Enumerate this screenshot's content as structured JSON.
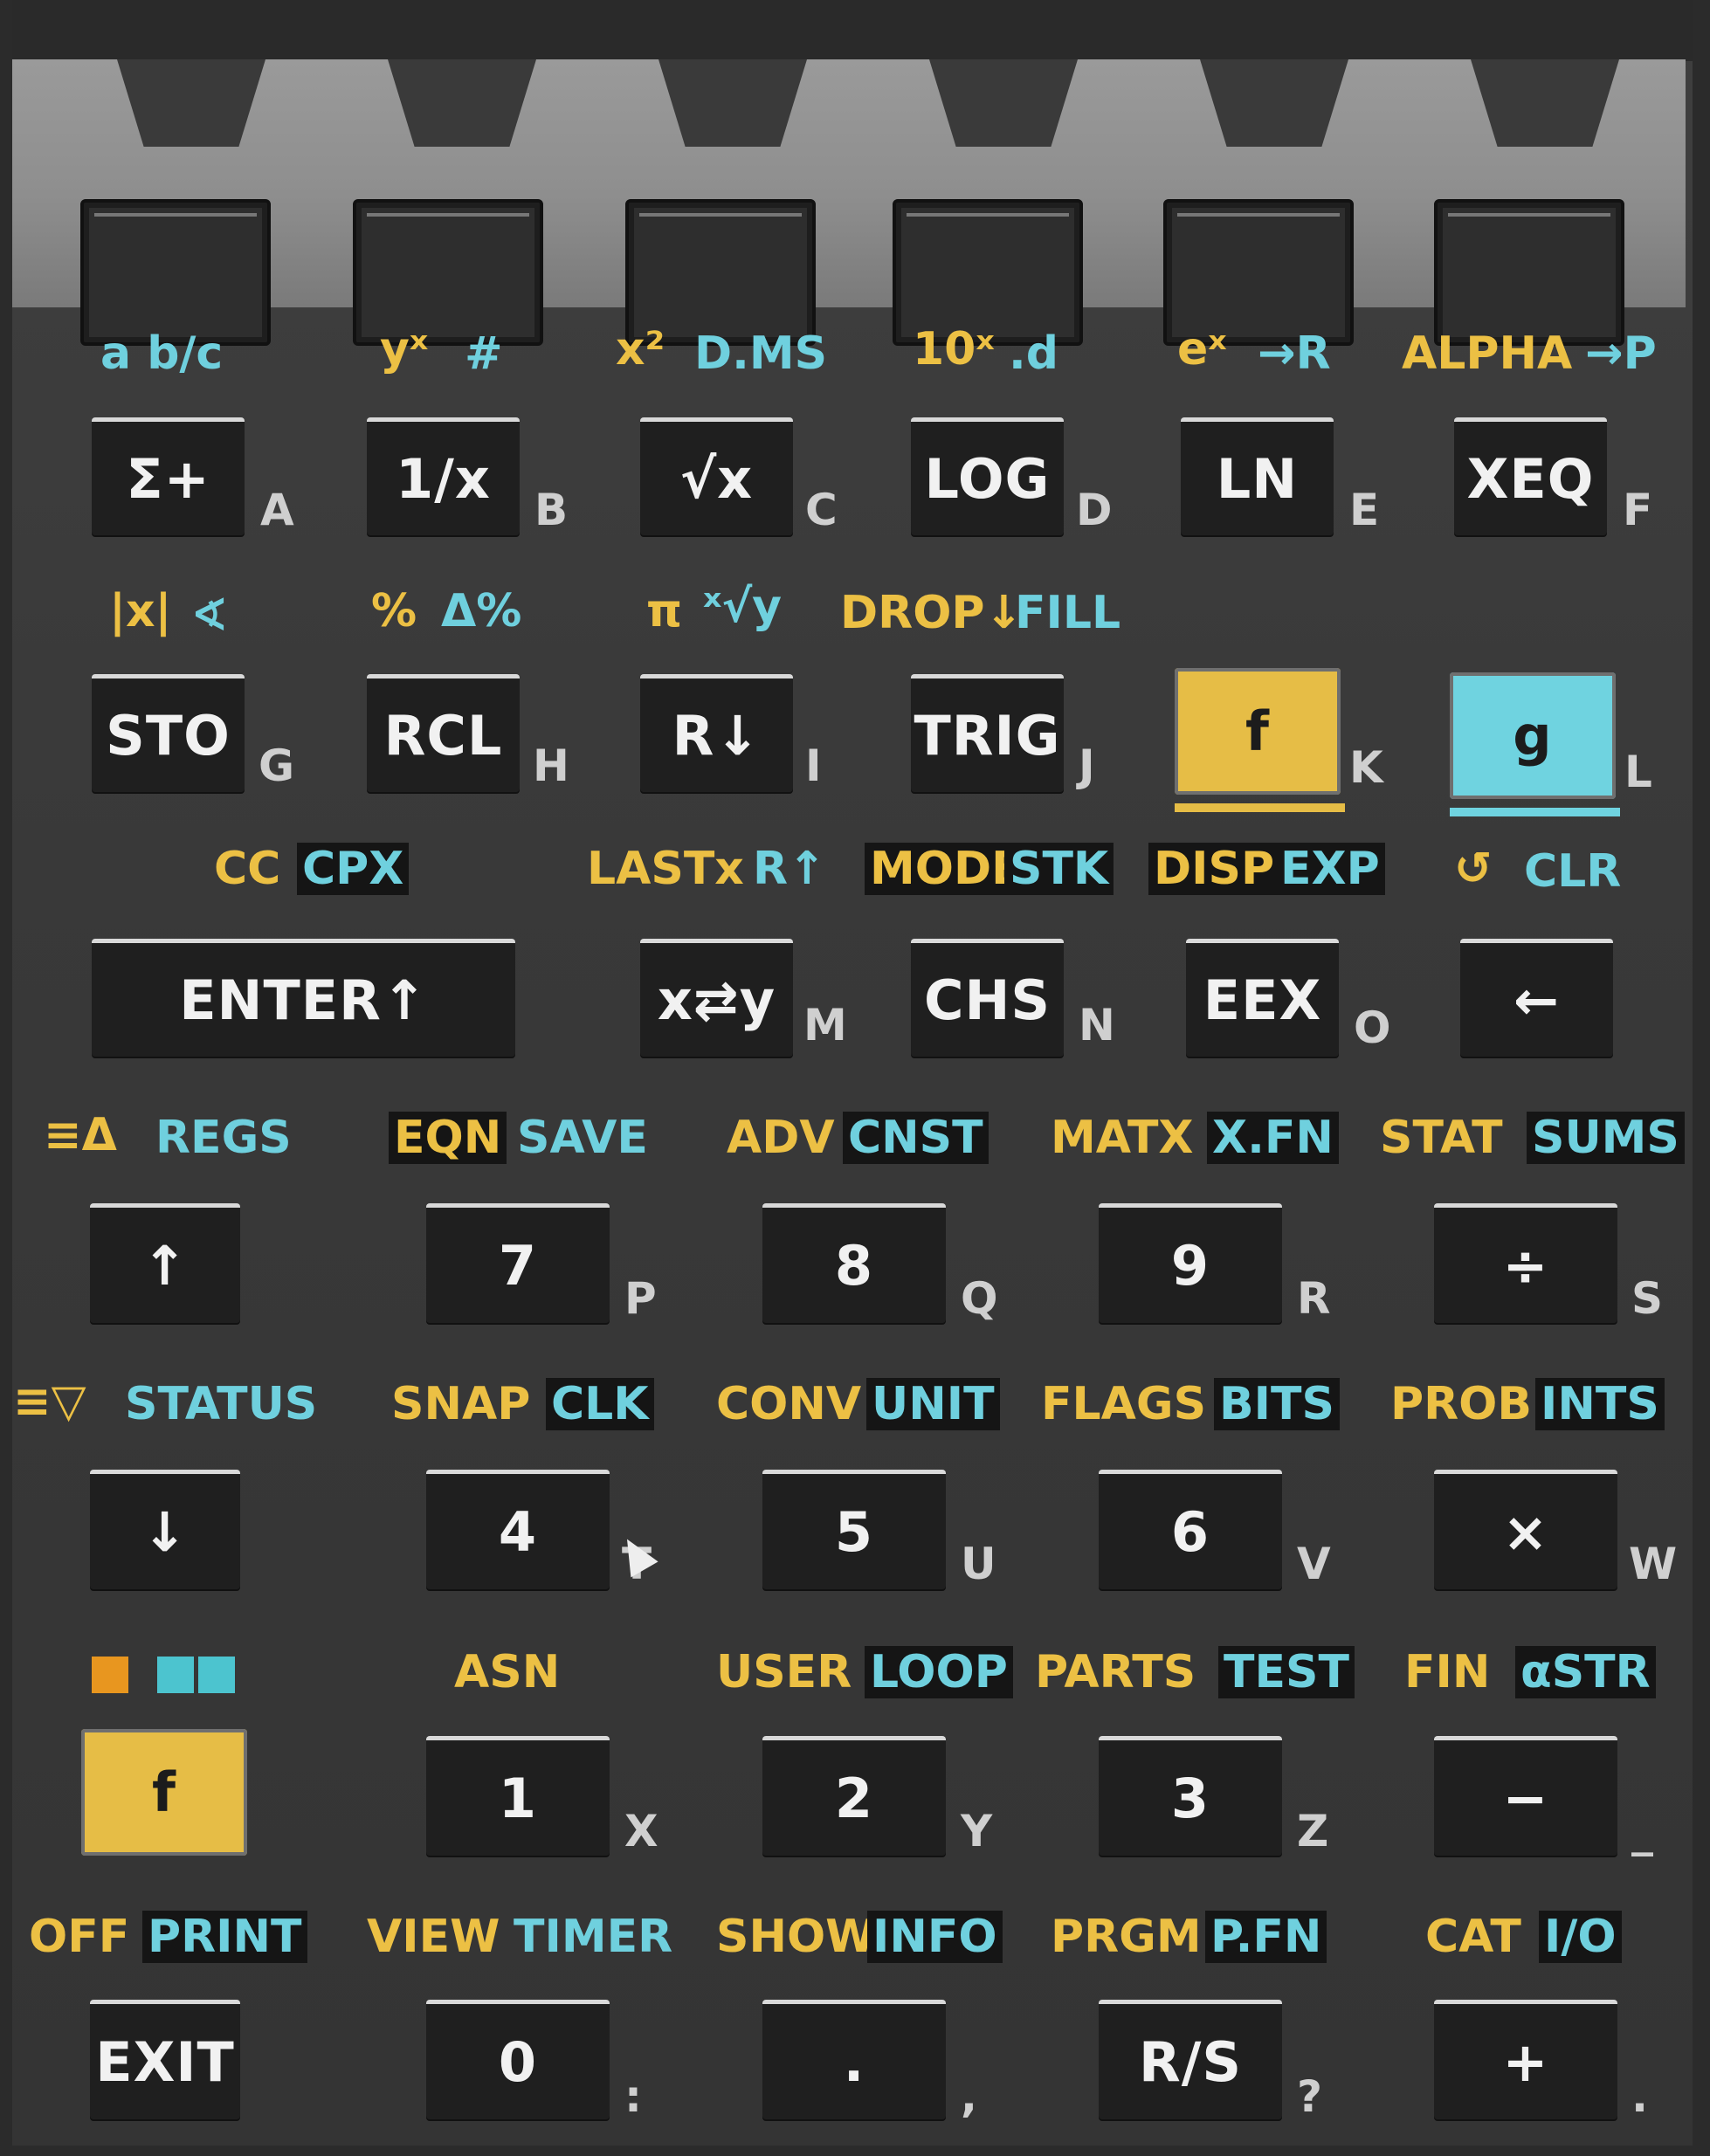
{
  "colors": {
    "gold": "#ecc044",
    "cyan": "#6fd0de",
    "key_bg": "#1f1f1f",
    "body": "#3a3a3a",
    "f_key": "#e6bd46",
    "g_key": "#6fd3e0"
  },
  "softkeys": [
    "",
    "",
    "",
    "",
    "",
    ""
  ],
  "row1": {
    "labels": [
      {
        "gold": "",
        "cyan": "a b/c"
      },
      {
        "gold": "yˣ",
        "cyan": "#"
      },
      {
        "gold": "x²",
        "cyan": "D.MS"
      },
      {
        "gold": "10ˣ",
        "cyan": ".d"
      },
      {
        "gold": "eˣ",
        "cyan": "→R"
      },
      {
        "gold": "ALPHA",
        "cyan": "→P"
      }
    ],
    "keys": [
      "Σ+",
      "1/x",
      "√x",
      "LOG",
      "LN",
      "XEQ"
    ],
    "letters": [
      "A",
      "B",
      "C",
      "D",
      "E",
      "F"
    ]
  },
  "row2": {
    "labels": [
      {
        "gold": "|x|",
        "cyan": "∢"
      },
      {
        "gold": "%",
        "cyan": "Δ%"
      },
      {
        "gold": "π",
        "cyan": "ˣ√y"
      },
      {
        "gold": "DROP↓",
        "cyan": "FILL"
      },
      {
        "gold": "",
        "cyan": ""
      },
      {
        "gold": "",
        "cyan": ""
      }
    ],
    "keys": [
      "STO",
      "RCL",
      "R↓",
      "TRIG",
      "f",
      "g"
    ],
    "letters": [
      "G",
      "H",
      "I",
      "J",
      "K",
      "L"
    ]
  },
  "row3": {
    "labels": [
      {
        "gold": "CC",
        "cyan": "CPX"
      },
      {
        "gold": "LASTx",
        "cyan": "R↑"
      },
      {
        "gold": "MODE",
        "cyan": "STK"
      },
      {
        "gold": "DISP",
        "cyan": "EXP"
      },
      {
        "gold": "↺",
        "cyan": "CLR"
      }
    ],
    "keys": [
      "ENTER↑",
      "x⇄y",
      "CHS",
      "EEX",
      "←"
    ],
    "letters": [
      "",
      "M",
      "N",
      "O",
      ""
    ]
  },
  "row4": {
    "labels": [
      {
        "gold": "≡Δ",
        "cyan": "REGS"
      },
      {
        "gold": "EQN",
        "cyan": "SAVE"
      },
      {
        "gold": "ADV",
        "cyan": "CNST"
      },
      {
        "gold": "MATX",
        "cyan": "X.FN"
      },
      {
        "gold": "STAT",
        "cyan": "SUMS"
      }
    ],
    "keys": [
      "↑",
      "7",
      "8",
      "9",
      "÷"
    ],
    "letters": [
      "",
      "P",
      "Q",
      "R",
      "S"
    ]
  },
  "row5": {
    "labels": [
      {
        "gold": "≡▽",
        "cyan": "STATUS"
      },
      {
        "gold": "SNAP",
        "cyan": "CLK"
      },
      {
        "gold": "CONV",
        "cyan": "UNIT"
      },
      {
        "gold": "FLAGS",
        "cyan": "BITS"
      },
      {
        "gold": "PROB",
        "cyan": "INTS"
      }
    ],
    "keys": [
      "↓",
      "4",
      "5",
      "6",
      "×"
    ],
    "letters": [
      "",
      "T",
      "U",
      "V",
      "W"
    ]
  },
  "row6": {
    "labels": [
      {
        "gold": "",
        "cyan": ""
      },
      {
        "gold": "ASN",
        "cyan": ""
      },
      {
        "gold": "USER",
        "cyan": "LOOP"
      },
      {
        "gold": "PARTS",
        "cyan": "TEST"
      },
      {
        "gold": "FIN",
        "cyan": "αSTR"
      }
    ],
    "keys": [
      "f",
      "1",
      "2",
      "3",
      "−"
    ],
    "letters": [
      "",
      "X",
      "Y",
      "Z",
      "_"
    ]
  },
  "row7": {
    "labels": [
      {
        "gold": "OFF",
        "cyan": "PRINT"
      },
      {
        "gold": "VIEW",
        "cyan": "TIMER"
      },
      {
        "gold": "SHOW",
        "cyan": "INFO"
      },
      {
        "gold": "PRGM",
        "cyan": "P.FN"
      },
      {
        "gold": "CAT",
        "cyan": "I/O"
      }
    ],
    "keys": [
      "EXIT",
      "0",
      ".",
      "R/S",
      "+"
    ],
    "letters": [
      "",
      ":",
      ",",
      "?",
      "."
    ]
  }
}
